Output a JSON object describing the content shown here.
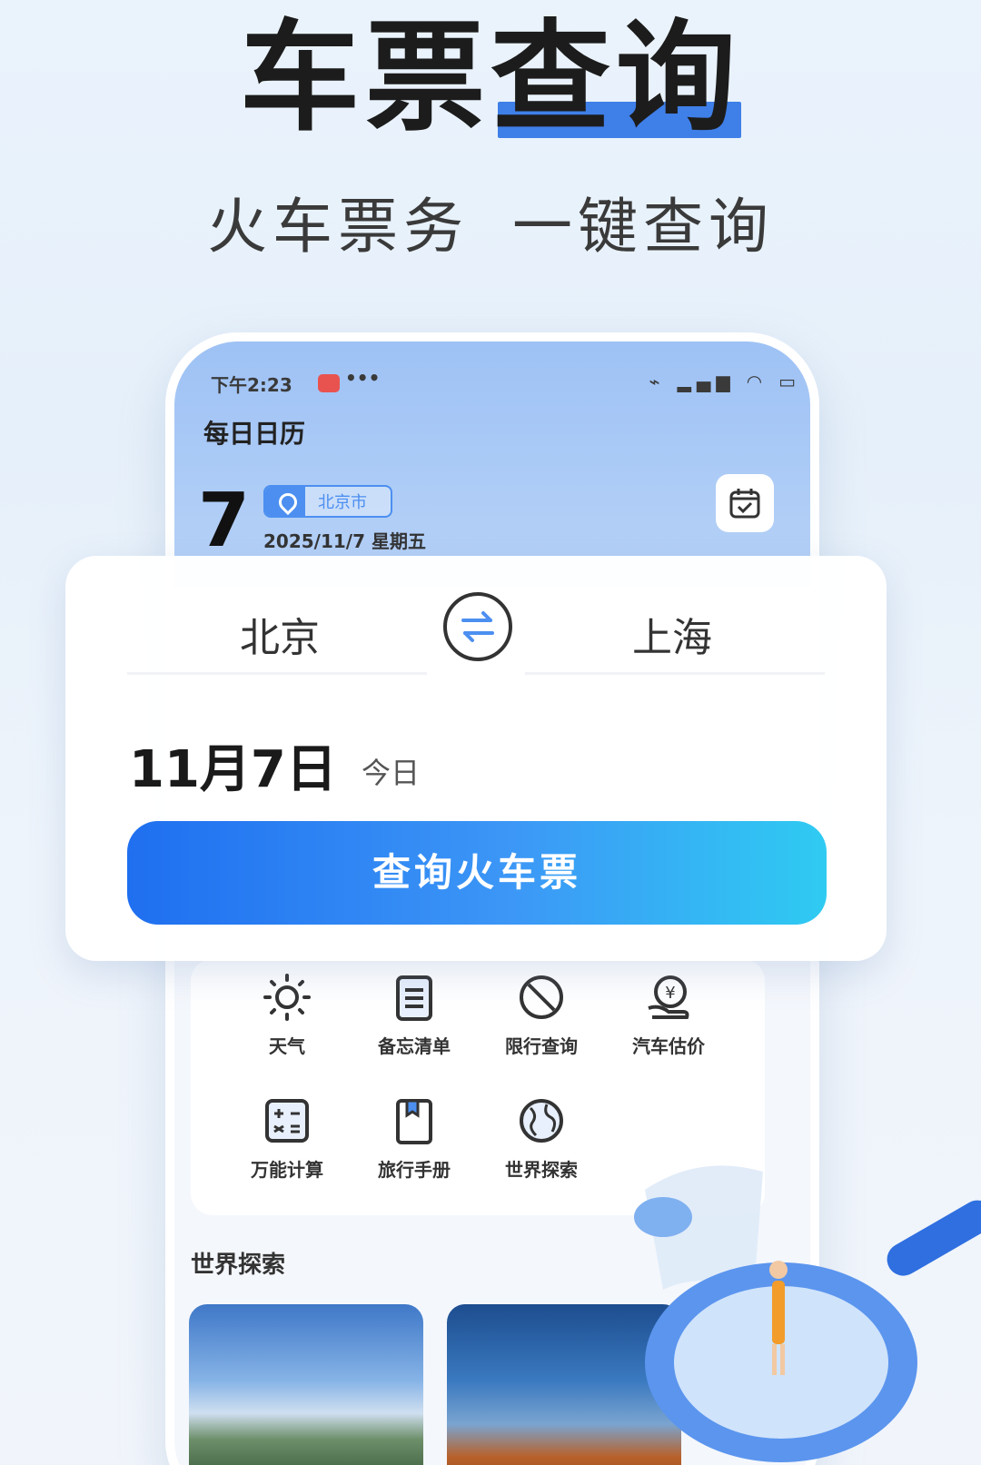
{
  "headline": "车票查询",
  "subtitle": {
    "part1": "火车票务",
    "part2": "一键查询"
  },
  "status_bar": {
    "time": "下午2:23",
    "more": "•••",
    "icons": "⌁ ▂▄▆ ◠ ▭"
  },
  "app": {
    "title": "每日日历",
    "day": "7",
    "location": "北京市",
    "full_date": "2025/11/7 星期五"
  },
  "search": {
    "from_station": "北京",
    "to_station": "上海",
    "date": "11月7日",
    "date_hint": "今日",
    "button_label": "查询火车票"
  },
  "tools": [
    {
      "label": "天气",
      "icon": "sun-icon"
    },
    {
      "label": "备忘清单",
      "icon": "memo-icon"
    },
    {
      "label": "限行查询",
      "icon": "no-entry-icon"
    },
    {
      "label": "汽车估价",
      "icon": "car-valuation-icon"
    },
    {
      "label": "万能计算",
      "icon": "calculator-icon"
    },
    {
      "label": "旅行手册",
      "icon": "travel-book-icon"
    },
    {
      "label": "世界探索",
      "icon": "globe-icon"
    }
  ],
  "section": {
    "title": "世界探索"
  },
  "colors": {
    "accent": "#3f7fe8",
    "button_start": "#1f6ff0",
    "button_end": "#2fcbf2"
  }
}
